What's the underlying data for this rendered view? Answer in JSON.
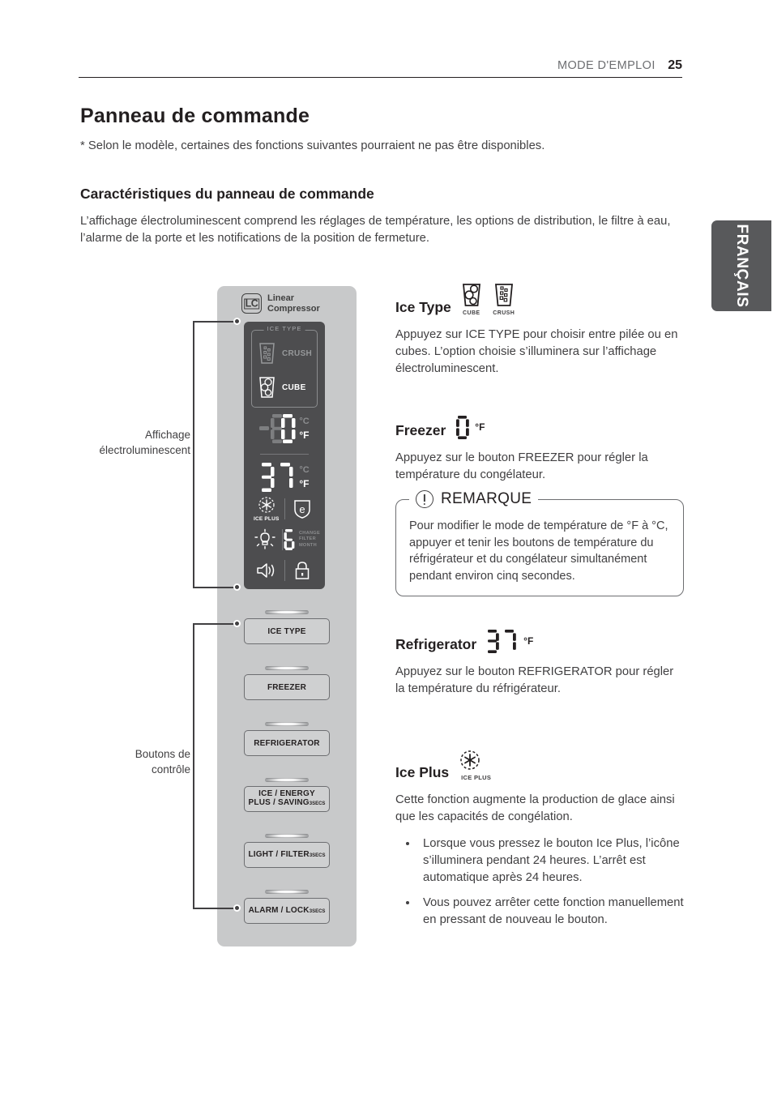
{
  "header": {
    "section": "MODE D'EMPLOI",
    "page_number": "25",
    "language_tab": "FRANÇAIS"
  },
  "titles": {
    "h1": "Panneau de commande",
    "note": "* Selon le modèle, certaines des fonctions suivantes pourraient ne pas être disponibles.",
    "h2": "Caractéristiques du panneau de commande",
    "intro": "L’affichage électroluminescent comprend les réglages de température, les options de distribution, le filtre à eau, l’alarme de la porte et les notifications de la position de fermeture."
  },
  "diagram": {
    "logo": {
      "mark": "LC",
      "line1": "Linear",
      "line2": "Compressor"
    },
    "display": {
      "ice_type_caption": "ICE TYPE",
      "crush_label": "CRUSH",
      "cube_label": "CUBE",
      "freezer_temp": "0",
      "freezer_unit_c": "°C",
      "freezer_unit_f": "°F",
      "fridge_temp": "37",
      "fridge_unit_c": "°C",
      "fridge_unit_f": "°F",
      "ice_plus_caption": "ICE PLUS",
      "energy_icon_letter": "e",
      "filter_months": "6",
      "filter_caption_line1": "CHANGE",
      "filter_caption_line2": "FILTER",
      "filter_caption_line3": "MONTH"
    },
    "buttons": [
      {
        "label": "ICE TYPE",
        "secs": ""
      },
      {
        "label": "FREEZER",
        "secs": ""
      },
      {
        "label": "REFRIGERATOR",
        "secs": ""
      },
      {
        "label_line1": "ICE    / ENERGY",
        "label_line2": "PLUS / SAVING",
        "secs": "3SECS"
      },
      {
        "label": "LIGHT / FILTER",
        "secs": "3SECS"
      },
      {
        "label": "ALARM / LOCK",
        "secs": "3SECS"
      }
    ],
    "callouts": {
      "display_label_line1": "Affichage",
      "display_label_line2": "électroluminescent",
      "buttons_label_line1": "Boutons de",
      "buttons_label_line2": "contrôle"
    }
  },
  "sections": {
    "ice_type": {
      "title": "Ice Type",
      "icon_cube_caption": "CUBE",
      "icon_crush_caption": "CRUSH",
      "body": "Appuyez sur ICE TYPE pour choisir entre pilée ou en cubes. L’option choisie s’illuminera sur l’affichage électroluminescent."
    },
    "freezer": {
      "title": "Freezer",
      "value": "0",
      "unit": "°F",
      "body": "Appuyez sur le bouton FREEZER pour régler la température du congélateur."
    },
    "remarque": {
      "title": "REMARQUE",
      "body": "Pour modifier le mode de température de °F à °C, appuyer et tenir les boutons de température du réfrigérateur et du congélateur simultanément pendant environ cinq secondes."
    },
    "refrigerator": {
      "title": "Refrigerator",
      "value": "37",
      "unit": "°F",
      "body": "Appuyez sur le bouton REFRIGERATOR pour régler la température du réfrigérateur."
    },
    "ice_plus": {
      "title": "Ice Plus",
      "icon_caption": "ICE PLUS",
      "body": "Cette fonction augmente la production de glace ainsi que les capacités de congélation.",
      "bullets": [
        "Lorsque vous pressez le bouton Ice Plus, l’icône s’illuminera pendant 24 heures. L’arrêt est automatique après 24 heures.",
        "Vous pouvez arrêter cette fonction manuellement en pressant de nouveau le bouton."
      ]
    }
  },
  "colors": {
    "panel_bg": "#c8c9ca",
    "display_bg": "#4d4d4f",
    "tab_bg": "#58595b",
    "text": "#414042"
  }
}
